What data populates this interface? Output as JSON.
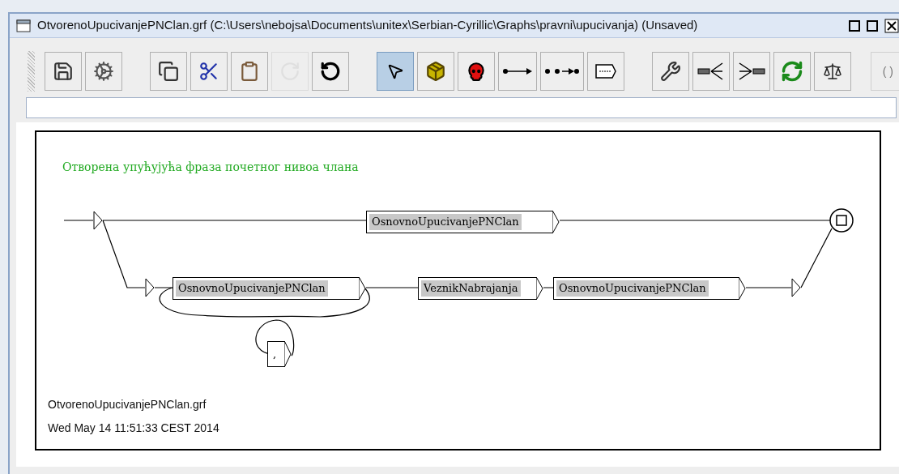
{
  "window": {
    "title": "OtvorenoUpucivanjePNClan.grf (C:\\Users\\nebojsa\\Documents\\unitex\\Serbian-Cyrillic\\Graphs\\pravni\\upucivanja) (Unsaved)"
  },
  "toolbar": [
    [
      {
        "kind": "save",
        "selected": false,
        "disabled": false
      },
      {
        "kind": "gear",
        "selected": false,
        "disabled": false
      }
    ],
    [
      {
        "kind": "copy",
        "selected": false,
        "disabled": false
      },
      {
        "kind": "cut",
        "selected": false,
        "disabled": false
      },
      {
        "kind": "paste",
        "selected": false,
        "disabled": false
      },
      {
        "kind": "redo",
        "selected": false,
        "disabled": true
      },
      {
        "kind": "undo",
        "selected": false,
        "disabled": false
      }
    ],
    [
      {
        "kind": "pointer",
        "selected": true,
        "disabled": false
      },
      {
        "kind": "package",
        "selected": false,
        "disabled": false
      },
      {
        "kind": "skull",
        "selected": false,
        "disabled": false
      },
      {
        "kind": "link",
        "selected": false,
        "disabled": false
      },
      {
        "kind": "reverse-link",
        "selected": false,
        "disabled": false
      },
      {
        "kind": "box",
        "selected": false,
        "disabled": false
      }
    ],
    [
      {
        "kind": "wrench",
        "selected": false,
        "disabled": false
      },
      {
        "kind": "split",
        "selected": false,
        "disabled": false
      },
      {
        "kind": "merge",
        "selected": false,
        "disabled": false
      },
      {
        "kind": "refresh",
        "selected": false,
        "disabled": false
      },
      {
        "kind": "scale",
        "selected": false,
        "disabled": false
      }
    ]
  ],
  "toolbar_text": "( )",
  "graph": {
    "comment": "Отворена упућујућа фраза почетног нивоа члана",
    "boxes": [
      {
        "kind": "call",
        "label": "OsnovnoUpucivanjePNClan"
      },
      {
        "kind": "call",
        "label": "OsnovnoUpucivanjePNClan"
      },
      {
        "kind": "call",
        "label": "VeznikNabrajanja"
      },
      {
        "kind": "call",
        "label": "OsnovnoUpucivanjePNClan"
      },
      {
        "kind": "token",
        "label": ","
      }
    ],
    "footer": [
      "OtvorenoUpucivanjePNClan.grf",
      "Wed May 14 11:51:33 CEST 2014"
    ]
  }
}
